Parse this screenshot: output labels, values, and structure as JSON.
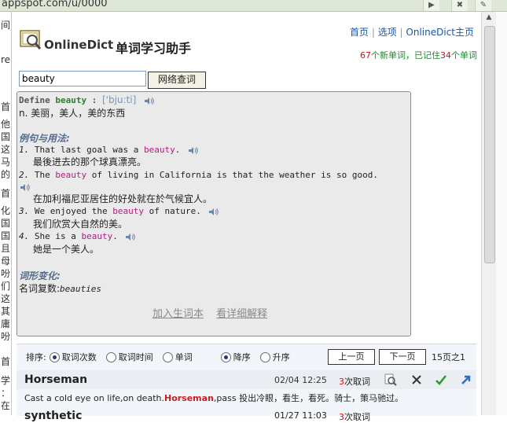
{
  "browser": {
    "url_fragment": "appspot.com/u/0000"
  },
  "header": {
    "brand": "OnlineDict",
    "title": "单词学习助手",
    "links": [
      "首页",
      "选项",
      "OnlineDict主页"
    ],
    "stats": {
      "new_count": "67",
      "new_label": "个新单词，已记住",
      "known_count": "34",
      "known_label": "个单词"
    }
  },
  "search": {
    "value": "beauty",
    "button": "网络查词"
  },
  "definition": {
    "define_label": "Define",
    "word": "beauty",
    "phonetic": "['bju:ti]",
    "meaning": "n. 美丽，美人，美的东西",
    "examples_heading": "例句与用法:",
    "examples": [
      {
        "num": "1.",
        "before": "That last goal was a ",
        "hl": "beauty",
        "after": ".",
        "trans": "最後进去的那个球真漂亮。"
      },
      {
        "num": "2.",
        "before": "The ",
        "hl": "beauty",
        "after": " of living in California is that the weather is so good.",
        "trans": "在加利福尼亚居住的好处就在於气候宜人。"
      },
      {
        "num": "3.",
        "before": "We enjoyed the ",
        "hl": "beauty",
        "after": " of nature.",
        "trans": "我们欣赏大自然的美。"
      },
      {
        "num": "4.",
        "before": "She is a ",
        "hl": "beauty",
        "after": ".",
        "trans": "她是一个美人。"
      }
    ],
    "forms_heading": "词形变化:",
    "plural_label": "名词复数:",
    "plural_value": "beauties",
    "actions": [
      "加入生词本",
      "看详细解释"
    ]
  },
  "list": {
    "sort_label": "排序:",
    "sort_options": [
      "取词次数",
      "取词时间",
      "单词"
    ],
    "order_options": [
      "降序",
      "升序"
    ],
    "prev": "上一页",
    "next": "下一页",
    "page_info": "15页之1",
    "entries": [
      {
        "word": "Horseman",
        "date": "02/04 12:25",
        "count": "3",
        "count_label": "次取词",
        "ex_before": "Cast a cold eye on life,on death.",
        "ex_hl": "Horseman",
        "ex_after": ",pass 投出冷眼，看生，看死。骑士，策马驰过。"
      },
      {
        "word": "synthetic",
        "date": "01/27 11:03",
        "count": "3",
        "count_label": "次取词"
      }
    ]
  },
  "colors": {
    "accent_link": "#1a56a6",
    "count_red": "#d01010",
    "highlight": "#b0207d",
    "word_green": "#2f7d2f"
  }
}
